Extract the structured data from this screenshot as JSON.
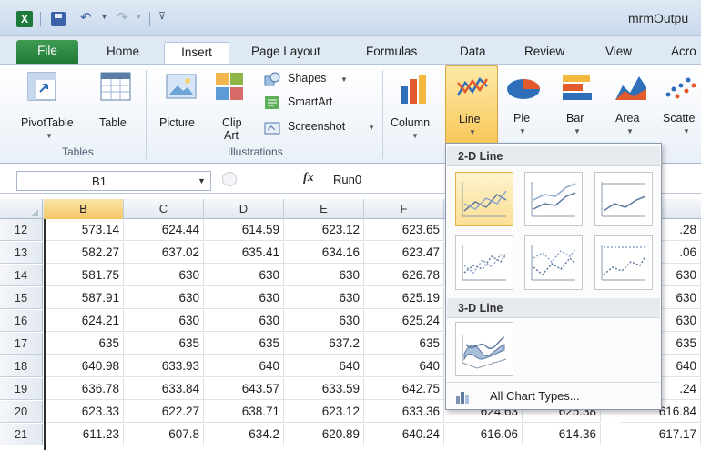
{
  "window": {
    "title": "mrmOutpu",
    "app_icon": "X"
  },
  "tabs": [
    {
      "label": "File"
    },
    {
      "label": "Home"
    },
    {
      "label": "Insert"
    },
    {
      "label": "Page Layout"
    },
    {
      "label": "Formulas"
    },
    {
      "label": "Data"
    },
    {
      "label": "Review"
    },
    {
      "label": "View"
    },
    {
      "label": "Acro"
    }
  ],
  "ribbon": {
    "tables": {
      "group_label": "Tables",
      "pivot": "PivotTable",
      "table": "Table"
    },
    "illustrations": {
      "group_label": "Illustrations",
      "picture": "Picture",
      "clip_art_1": "Clip",
      "clip_art_2": "Art",
      "shapes": "Shapes",
      "smartart": "SmartArt",
      "screenshot": "Screenshot"
    },
    "charts": {
      "column": "Column",
      "line": "Line",
      "pie": "Pie",
      "bar": "Bar",
      "area": "Area",
      "scatter": "Scatte"
    }
  },
  "formula_bar": {
    "name_box": "B1",
    "fx": "fx",
    "value": "Run0"
  },
  "grid": {
    "columns": [
      "B",
      "C",
      "D",
      "E",
      "F"
    ],
    "rows": [
      {
        "row": "12",
        "cells": [
          "573.14",
          "624.44",
          "614.59",
          "623.12",
          "623.65"
        ],
        "i": "",
        "j": ".28"
      },
      {
        "row": "13",
        "cells": [
          "582.27",
          "637.02",
          "635.41",
          "634.16",
          "623.47"
        ],
        "i": "",
        "j": ".06"
      },
      {
        "row": "14",
        "cells": [
          "581.75",
          "630",
          "630",
          "630",
          "626.78"
        ],
        "i": "",
        "j": "630"
      },
      {
        "row": "15",
        "cells": [
          "587.91",
          "630",
          "630",
          "630",
          "625.19"
        ],
        "i": "",
        "j": "630"
      },
      {
        "row": "16",
        "cells": [
          "624.21",
          "630",
          "630",
          "630",
          "625.24"
        ],
        "i": "",
        "j": "630"
      },
      {
        "row": "17",
        "cells": [
          "635",
          "635",
          "635",
          "637.2",
          "635"
        ],
        "i": "",
        "j": "635"
      },
      {
        "row": "18",
        "cells": [
          "640.98",
          "633.93",
          "640",
          "640",
          "640"
        ],
        "i": "",
        "j": "640"
      },
      {
        "row": "19",
        "cells": [
          "636.78",
          "633.84",
          "643.57",
          "633.59",
          "642.75"
        ],
        "i": "",
        "j": ".24"
      },
      {
        "row": "20",
        "cells": [
          "623.33",
          "622.27",
          "638.71",
          "623.12",
          "633.36",
          "624.63",
          "625.38"
        ],
        "j": "616.84"
      },
      {
        "row": "21",
        "cells": [
          "611.23",
          "607.8",
          "634.2",
          "620.89",
          "640.24",
          "616.06",
          "614.36"
        ],
        "j": "617.17"
      }
    ]
  },
  "line_dropdown": {
    "section_2d": "2-D Line",
    "section_3d": "3-D Line",
    "all_chart_types": "All Chart Types..."
  }
}
